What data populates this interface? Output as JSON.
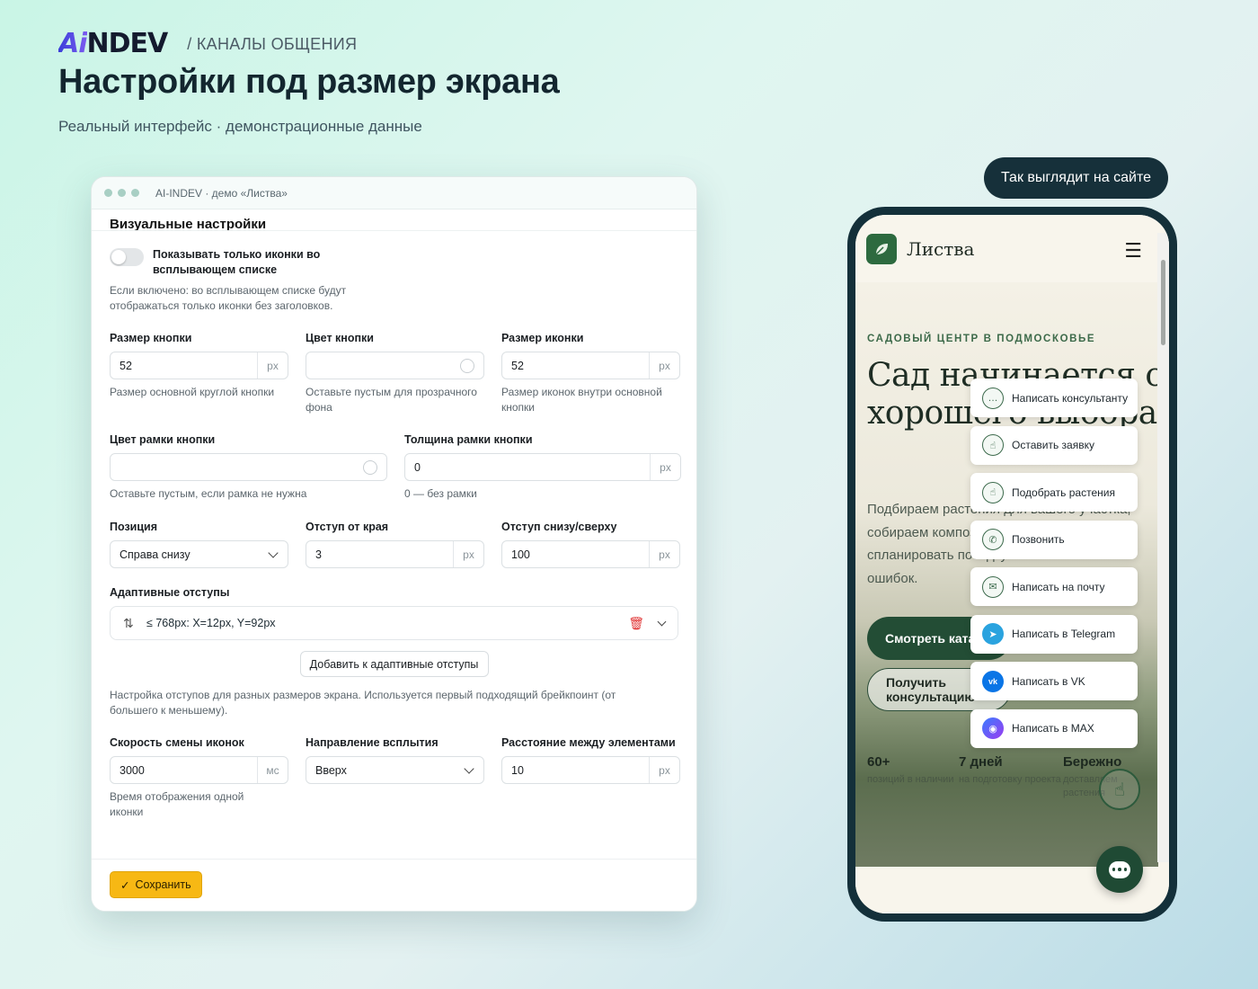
{
  "header": {
    "logo_text": "AINDEV",
    "breadcrumb": "/ КАНАЛЫ ОБЩЕНИЯ",
    "title": "Настройки под размер экрана",
    "subtitle": "Реальный интерфейс · демонстрационные данные"
  },
  "admin": {
    "window_title": "AI-INDEV · демо «Листва»",
    "section_title": "Визуальные настройки",
    "toggle_label": "Показывать только иконки во всплывающем списке",
    "toggle_on": false,
    "toggle_hint": "Если включено: во всплывающем списке будут отображаться только иконки без заголовков.",
    "row1": [
      {
        "label": "Размер кнопки",
        "value": "52",
        "unit": "px",
        "hint": "Размер основной круглой кнопки"
      },
      {
        "label": "Цвет кнопки",
        "value": "",
        "hint": "Оставьте пустым для прозрачного фона"
      },
      {
        "label": "Размер иконки",
        "value": "52",
        "unit": "px",
        "hint": "Размер иконок внутри основной кнопки"
      }
    ],
    "row2": [
      {
        "label": "Цвет рамки кнопки",
        "value": "",
        "hint": "Оставьте пустым, если рамка не нужна"
      },
      {
        "label": "Толщина рамки кнопки",
        "value": "0",
        "unit": "px",
        "hint": "0 — без рамки"
      }
    ],
    "row3": [
      {
        "label": "Позиция",
        "value": "Справа снизу"
      },
      {
        "label": "Отступ от края",
        "value": "3",
        "unit": "px"
      },
      {
        "label": "Отступ снизу/сверху",
        "value": "100",
        "unit": "px"
      }
    ],
    "adaptive": {
      "label": "Адаптивные отступы",
      "item": "≤ 768px: X=12px, Y=92px",
      "add_button": "Добавить к адаптивные отступы",
      "hint": "Настройка отступов для разных размеров экрана. Используется первый подходящий брейкпоинт (от большего к меньшему)."
    },
    "row4": [
      {
        "label": "Скорость смены иконок",
        "value": "3000",
        "unit": "мс",
        "hint": "Время отображения одной иконки"
      },
      {
        "label": "Направление всплытия",
        "value": "Вверх"
      },
      {
        "label": "Расстояние между элементами",
        "value": "10",
        "unit": "px"
      }
    ],
    "save_button": "Сохранить"
  },
  "preview": {
    "pill": "Так выглядит на сайте",
    "site_name": "Листва",
    "eyebrow": "САДОВЫЙ ЦЕНТР В ПОДМОСКОВЬЕ",
    "hero_title": "Сад начинается с хорошего выбора",
    "hero_text": "Подбираем растения для вашего участка, собираем композиции и помогаем спланировать посадку без лишних ошибок.",
    "cta_primary": "Смотреть каталог",
    "cta_secondary": "Получить консультацию",
    "stats": [
      {
        "value": "60+",
        "label": "позиций в наличии"
      },
      {
        "value": "7 дней",
        "label": "на подготовку проекта"
      },
      {
        "value": "Бережно",
        "label": "доставляем растения"
      }
    ],
    "menu": [
      {
        "label": "Написать консультанту",
        "icon": "chat-icon"
      },
      {
        "label": "Оставить заявку",
        "icon": "hand-icon"
      },
      {
        "label": "Подобрать растения",
        "icon": "hand-icon"
      },
      {
        "label": "Позвонить",
        "icon": "phone-icon"
      },
      {
        "label": "Написать на почту",
        "icon": "mail-icon"
      },
      {
        "label": "Написать в Telegram",
        "icon": "telegram-icon"
      },
      {
        "label": "Написать в VK",
        "icon": "vk-icon"
      },
      {
        "label": "Написать в MAX",
        "icon": "max-icon"
      }
    ]
  },
  "colors": {
    "accent_green": "#234d35",
    "save_yellow": "#f7b814",
    "pill_dark": "#16303a"
  }
}
